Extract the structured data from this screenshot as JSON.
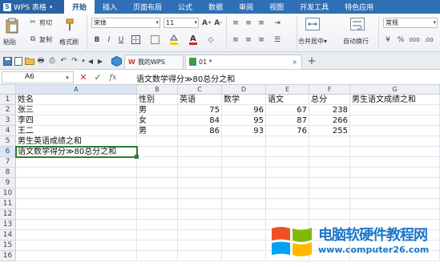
{
  "app": {
    "name": "WPS 表格"
  },
  "menu": {
    "tabs": [
      "开始",
      "插入",
      "页面布局",
      "公式",
      "数据",
      "审阅",
      "视图",
      "开发工具",
      "特色应用"
    ]
  },
  "ribbon": {
    "cut": "剪切",
    "copy": "复制",
    "format_painter": "格式刷",
    "paste": "粘贴",
    "font_name": "宋体",
    "font_size": "11",
    "merge_center": "合并居中",
    "wrap_text": "自动换行",
    "number_format": "常规"
  },
  "doc_tabs": [
    "我的WPS",
    "01 *"
  ],
  "formula_bar": {
    "name_box": "A6",
    "fx": "fx",
    "content": "语文数学得分≫80总分之和"
  },
  "columns": [
    "A",
    "B",
    "C",
    "D",
    "E",
    "F",
    "G"
  ],
  "rows": [
    [
      "姓名",
      "性别",
      "英语",
      "数学",
      "语文",
      "总分",
      "男生语文成绩之和"
    ],
    [
      "张三",
      "男",
      "75",
      "96",
      "67",
      "238",
      ""
    ],
    [
      "李四",
      "女",
      "84",
      "95",
      "87",
      "266",
      ""
    ],
    [
      "王二",
      "男",
      "86",
      "93",
      "76",
      "255",
      ""
    ],
    [
      "男生英语成绩之和",
      "",
      "",
      "",
      "",
      "",
      ""
    ],
    [
      "语文数学得分≫80总分之和",
      "",
      "",
      "",
      "",
      "",
      ""
    ],
    [
      "",
      "",
      "",
      "",
      "",
      "",
      ""
    ],
    [
      "",
      "",
      "",
      "",
      "",
      "",
      ""
    ],
    [
      "",
      "",
      "",
      "",
      "",
      "",
      ""
    ],
    [
      "",
      "",
      "",
      "",
      "",
      "",
      ""
    ],
    [
      "",
      "",
      "",
      "",
      "",
      "",
      ""
    ],
    [
      "",
      "",
      "",
      "",
      "",
      "",
      ""
    ],
    [
      "",
      "",
      "",
      "",
      "",
      "",
      ""
    ],
    [
      "",
      "",
      "",
      "",
      "",
      "",
      ""
    ],
    [
      "",
      "",
      "",
      "",
      "",
      "",
      ""
    ],
    [
      "",
      "",
      "",
      "",
      "",
      "",
      ""
    ]
  ],
  "watermark": {
    "title": "电脑软硬件教程网",
    "url": "www.computer26.com"
  },
  "colors": {
    "menubar": "#2f6fb5",
    "selection": "#2e7d32",
    "watermark": "#1b77c9"
  }
}
